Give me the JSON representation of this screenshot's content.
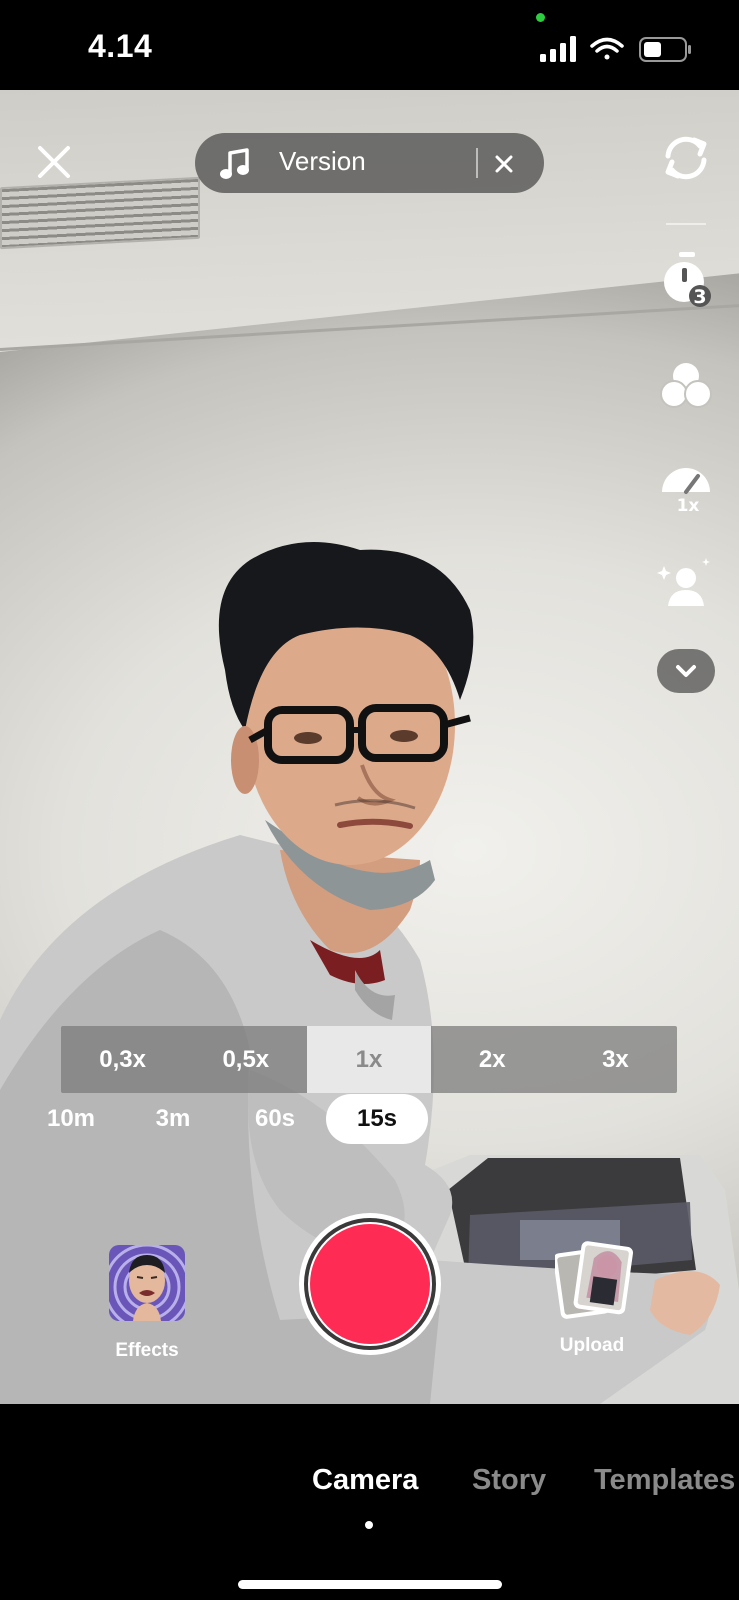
{
  "status_bar": {
    "time": "4.14",
    "icons": [
      "cellular-signal-icon",
      "wifi-icon",
      "battery-icon"
    ]
  },
  "top_bar": {
    "close_icon": "close-icon",
    "sound": {
      "icon": "music-note-icon",
      "title": "Version",
      "clear_icon": "close-icon"
    }
  },
  "side_tools": [
    "flip-camera-icon",
    "timer-3s-icon",
    "filters-icon",
    "speed-1x-icon",
    "beauty-icon",
    "more-chevron-icon"
  ],
  "zoom": {
    "options": [
      "0,3x",
      "0,5x",
      "1x",
      "2x",
      "3x"
    ],
    "selected": "1x"
  },
  "duration": {
    "options": [
      "10m",
      "3m",
      "60s",
      "15s"
    ],
    "selected": "15s"
  },
  "effects": {
    "label": "Effects"
  },
  "upload": {
    "label": "Upload"
  },
  "modes": {
    "items": [
      "Camera",
      "Story",
      "Templates"
    ],
    "selected": "Camera"
  },
  "colors": {
    "record": "#fe2c55",
    "pill": "#464646"
  }
}
